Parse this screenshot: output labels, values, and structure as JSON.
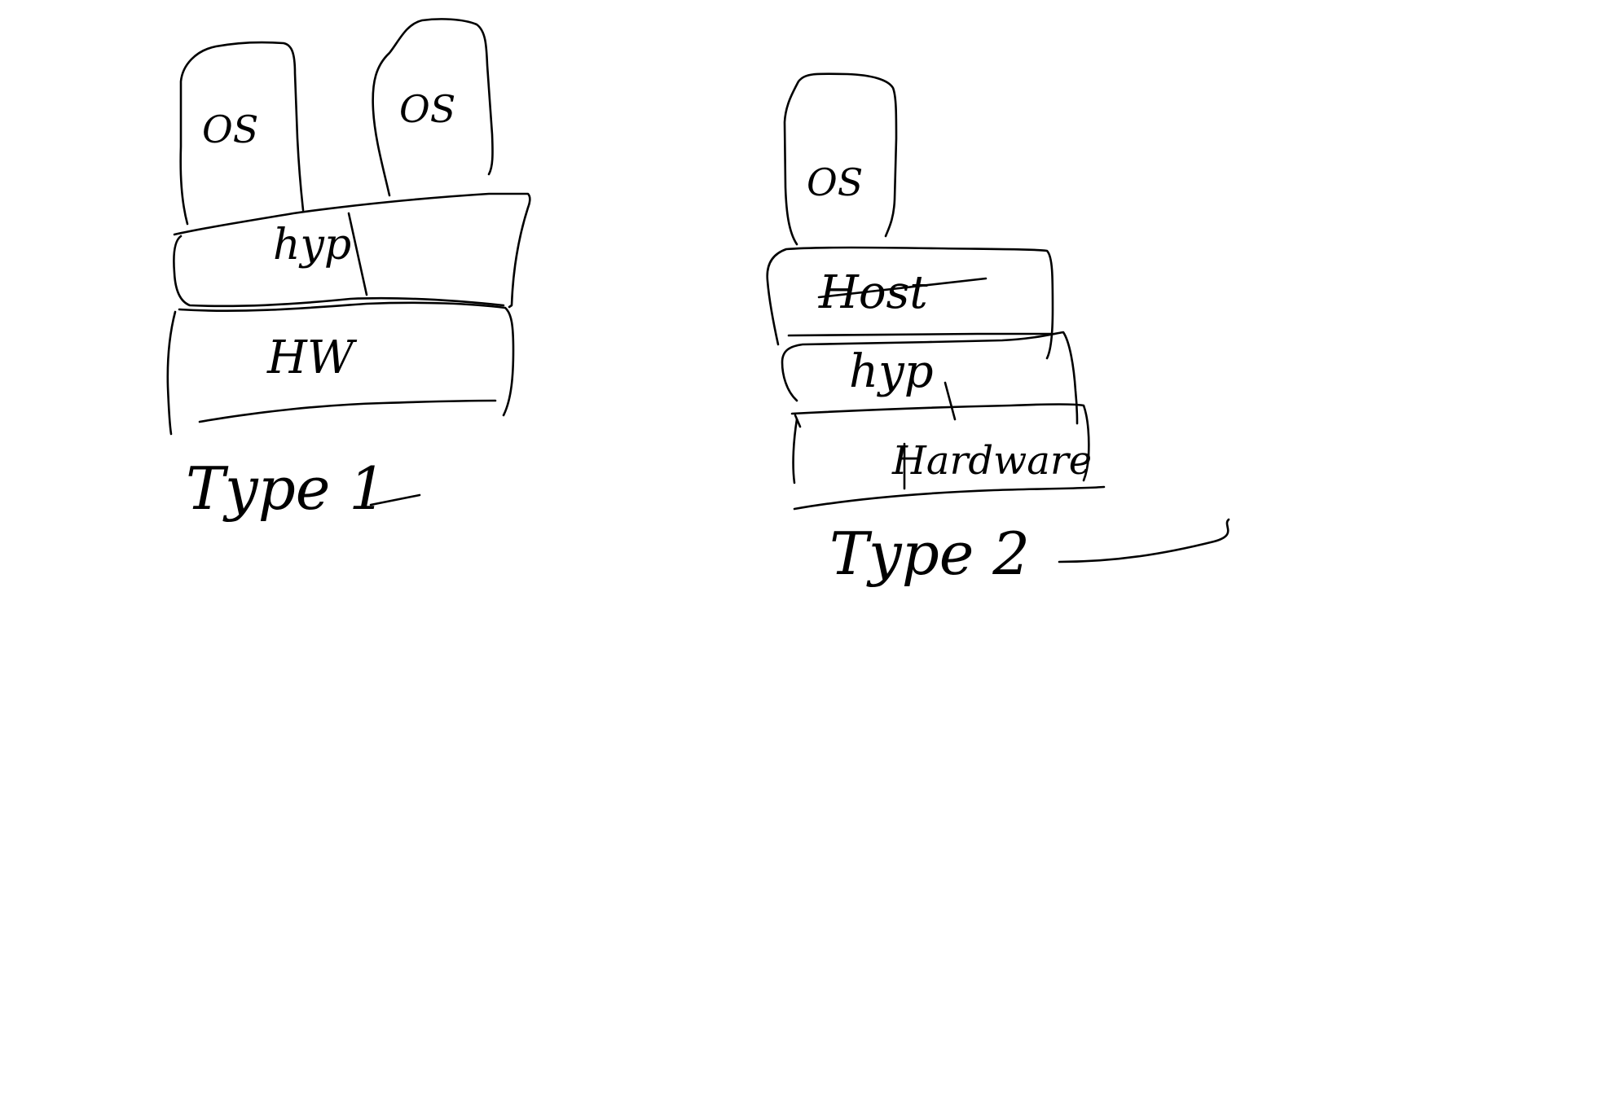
{
  "diagram": {
    "type1": {
      "guest_os_left": "OS",
      "guest_os_right": "OS",
      "hypervisor": "hyp",
      "hardware": "HW",
      "caption": "Type 1"
    },
    "type2": {
      "guest_os": "OS",
      "host": "Host",
      "hypervisor": "hyp",
      "hardware": "Hardware",
      "caption": "Type 2"
    },
    "colors": {
      "ink": "#000000",
      "background": "#ffffff"
    }
  }
}
